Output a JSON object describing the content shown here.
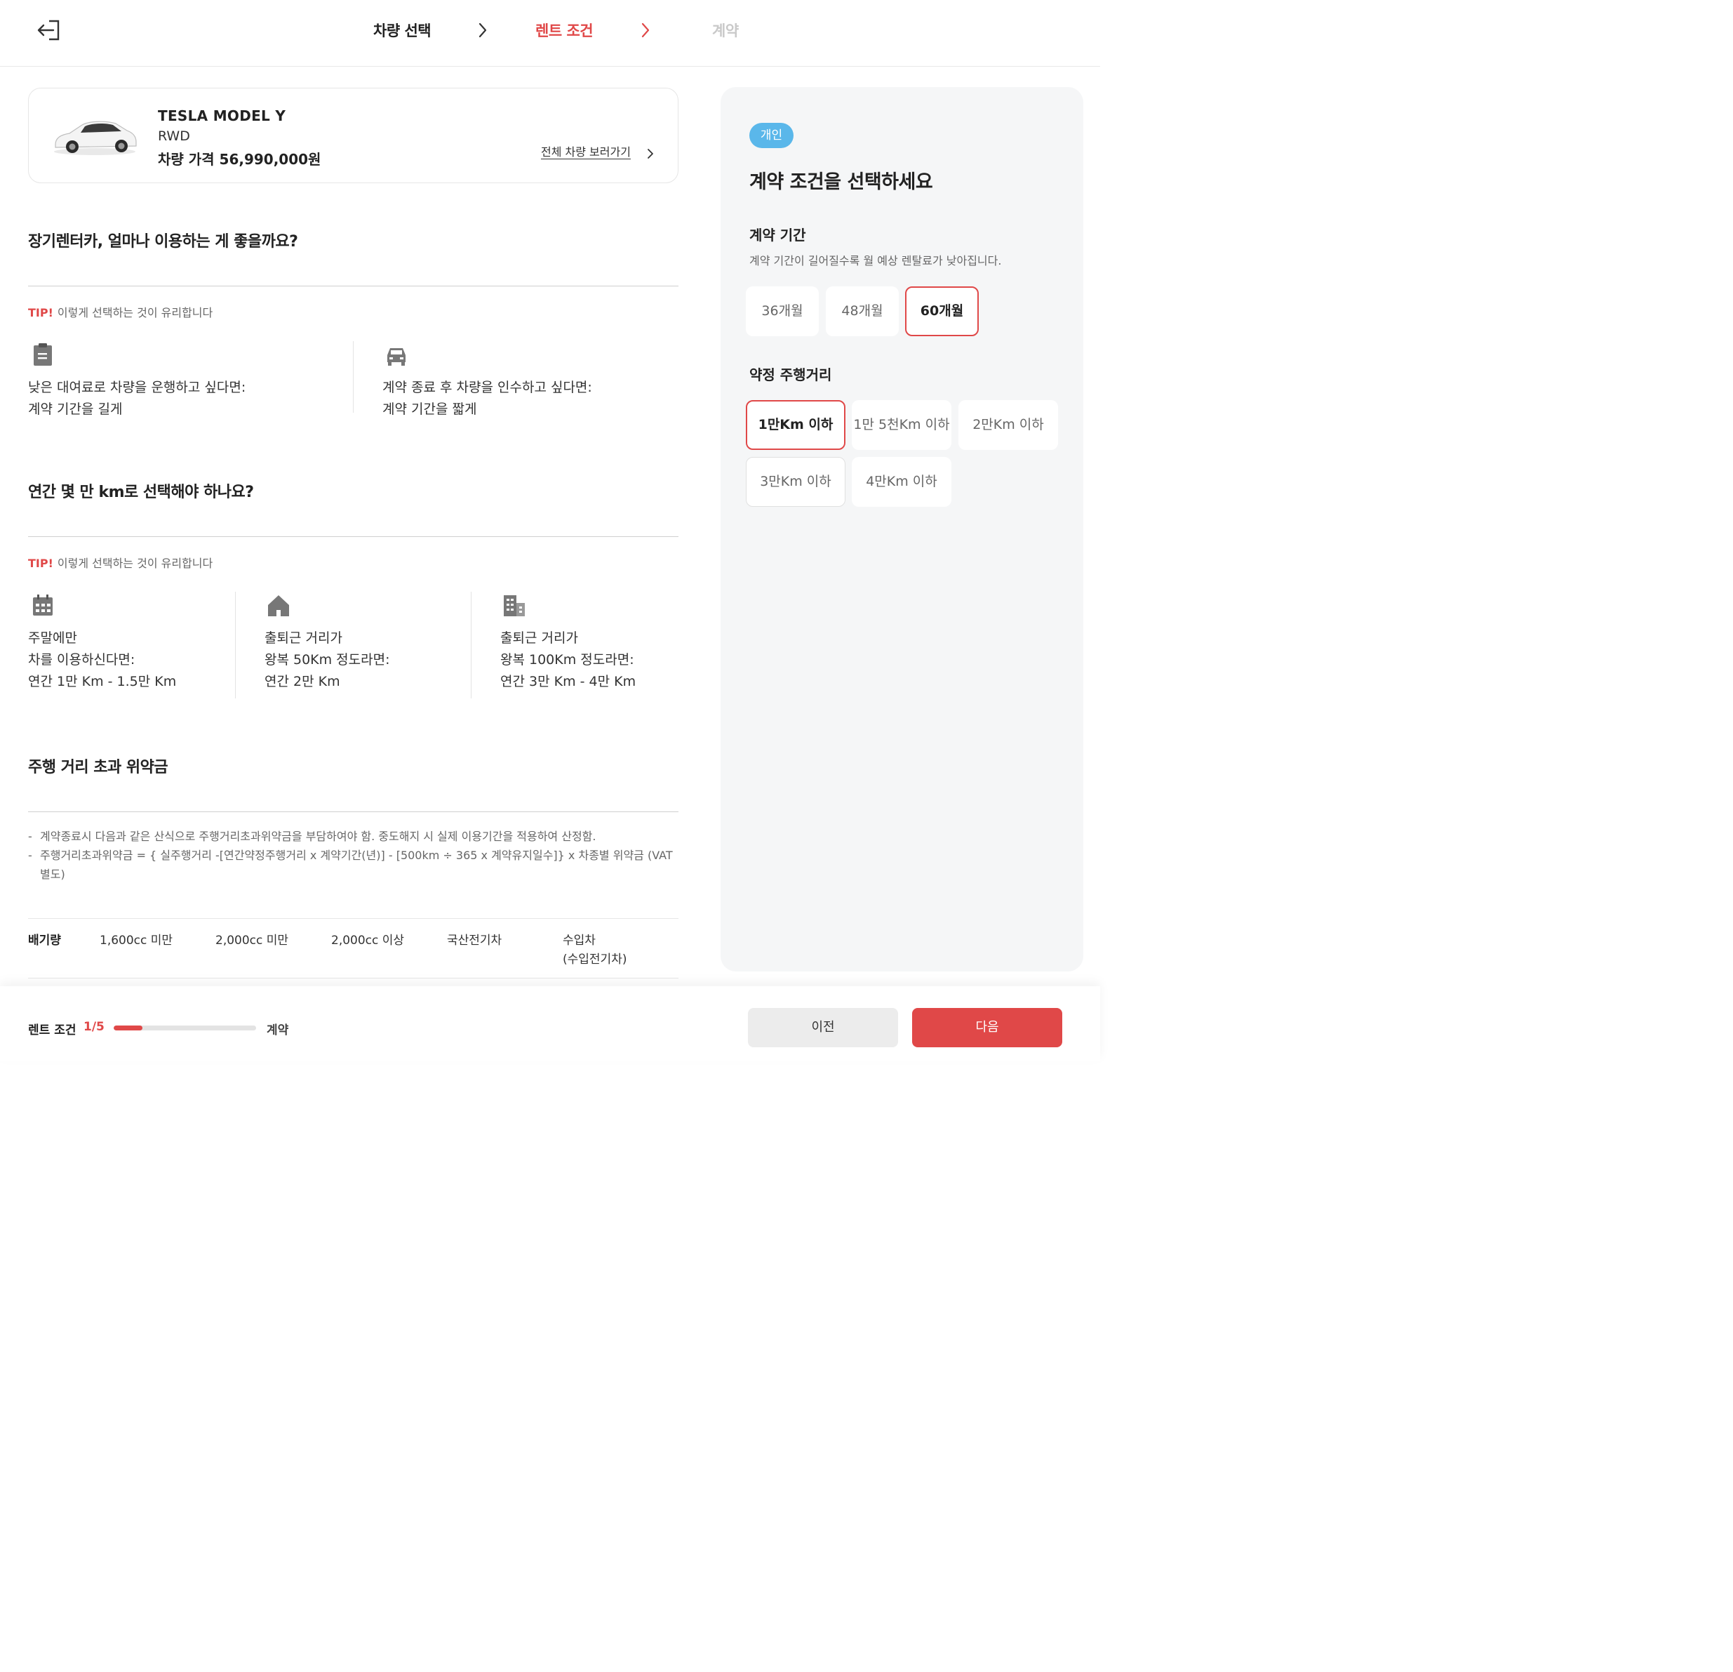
{
  "header": {
    "steps": [
      "차량 선택",
      "렌트 조건",
      "계약"
    ],
    "active_step_index": 1
  },
  "vehicle": {
    "name": "TESLA MODEL Y",
    "trim": "RWD",
    "price": "차량 가격 56,990,000원",
    "view_all_label": "전체 차량 보러가기"
  },
  "period_section": {
    "title": "장기렌터카, 얼마나 이용하는 게 좋을까요?",
    "tip_label": "TIP!",
    "tip_text": "이렇게 선택하는 것이 유리합니다",
    "items": [
      {
        "icon": "clipboard-icon",
        "text": "낮은 대여료로 차량을 운행하고 싶다면:\n계약 기간을 길게"
      },
      {
        "icon": "car-icon",
        "text": "계약 종료 후 차량을 인수하고 싶다면:\n계약 기간을 짧게"
      }
    ]
  },
  "mileage_section": {
    "title": "연간 몇 만 km로 선택해야 하나요?",
    "tip_label": "TIP!",
    "tip_text": "이렇게 선택하는 것이 유리합니다",
    "items": [
      {
        "icon": "calendar-icon",
        "text": "주말에만\n차를 이용하신다면:\n연간 1만 Km - 1.5만 Km"
      },
      {
        "icon": "house-icon",
        "text": "출퇴근 거리가\n왕복 50Km 정도라면:\n연간 2만 Km"
      },
      {
        "icon": "building-icon",
        "text": "출퇴근 거리가\n왕복 100Km 정도라면:\n연간 3만 Km - 4만 Km"
      }
    ]
  },
  "penalty_section": {
    "title": "주행 거리 초과 위약금",
    "notes": [
      "계약종료시 다음과 같은 산식으로 주행거리초과위약금을 부담하여야 함. 중도해지 시 실제 이용기간을 적용하여 산정함.",
      "주행거리초과위약금 = { 실주행거리 -[연간약정주행거리 x 계약기간(년)] - [500km ÷ 365 x 계약유지일수]} x 차종별 위약금 (VAT 별도)"
    ],
    "table_headers": [
      "배기량",
      "1,600cc 미만",
      "2,000cc 미만",
      "2,000cc 이상",
      "국산전기차",
      "수입차\n(수입전기차)"
    ]
  },
  "panel": {
    "badge": "개인",
    "title": "계약 조건을 선택하세요",
    "period_label": "계약 기간",
    "period_desc": "계약 기간이 길어질수록 월 예상 렌탈료가 낮아집니다.",
    "period_options": [
      "36개월",
      "48개월",
      "60개월"
    ],
    "period_selected": "60개월",
    "mileage_label": "약정 주행거리",
    "mileage_options": [
      "1만Km 이하",
      "1만 5천Km 이하",
      "2만Km 이하",
      "3만Km 이하",
      "4만Km 이하"
    ],
    "mileage_selected": "1만Km 이하"
  },
  "bottom_bar": {
    "current_step": "렌트 조건",
    "step_count": "1/5",
    "progress": 0.2,
    "next_step": "계약",
    "prev_label": "이전",
    "next_label": "다음"
  },
  "colors": {
    "accent": "#e04848",
    "badge": "#5ab7ea",
    "panel_bg": "#f5f6f7"
  }
}
